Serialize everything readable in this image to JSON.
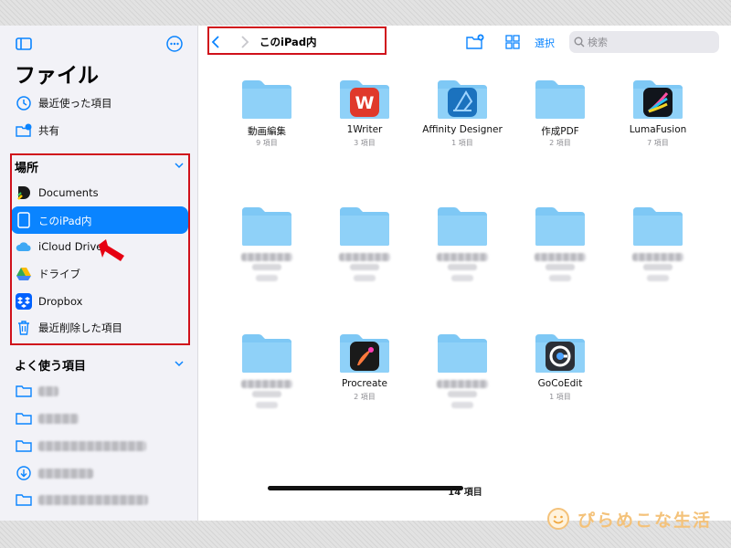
{
  "sidebar": {
    "title": "ファイル",
    "top_items": [
      {
        "label": "最近使った項目",
        "icon": "clock-icon"
      },
      {
        "label": "共有",
        "icon": "shared-folder-icon"
      }
    ],
    "locations_header": "場所",
    "locations": [
      {
        "label": "Documents",
        "icon": "documents-app-icon"
      },
      {
        "label": "このiPad内",
        "icon": "ipad-icon",
        "selected": true
      },
      {
        "label": "iCloud Drive",
        "icon": "icloud-icon"
      },
      {
        "label": "ドライブ",
        "icon": "google-drive-icon"
      },
      {
        "label": "Dropbox",
        "icon": "dropbox-icon"
      },
      {
        "label": "最近削除した項目",
        "icon": "trash-icon"
      }
    ],
    "favorites_header": "よく使う項目",
    "favorites": [
      {
        "label": "",
        "icon": "folder-icon"
      },
      {
        "label": "",
        "icon": "folder-icon"
      },
      {
        "label": "",
        "icon": "folder-icon"
      },
      {
        "label": "",
        "icon": "download-icon"
      },
      {
        "label": "",
        "icon": "folder-icon"
      }
    ]
  },
  "toolbar": {
    "title": "このiPad内",
    "select_label": "選択",
    "search_placeholder": "検索"
  },
  "grid": [
    {
      "name": "動画編集",
      "count": "9 項目",
      "app_icon": null
    },
    {
      "name": "1Writer",
      "count": "3 項目",
      "app_icon": "1writer-icon"
    },
    {
      "name": "Affinity Designer",
      "count": "1 項目",
      "app_icon": "affinity-designer-icon"
    },
    {
      "name": "作成PDF",
      "count": "2 項目",
      "app_icon": null
    },
    {
      "name": "LumaFusion",
      "count": "7 項目",
      "app_icon": "lumafusion-icon"
    },
    {
      "name": "",
      "count": "",
      "app_icon": null
    },
    {
      "name": "",
      "count": "",
      "app_icon": null
    },
    {
      "name": "",
      "count": "",
      "app_icon": null
    },
    {
      "name": "",
      "count": "",
      "app_icon": null
    },
    {
      "name": "",
      "count": "",
      "app_icon": null
    },
    {
      "name": "",
      "count": "",
      "app_icon": null
    },
    {
      "name": "Procreate",
      "count": "2 項目",
      "app_icon": "procreate-icon"
    },
    {
      "name": "",
      "count": "",
      "app_icon": null
    },
    {
      "name": "GoCoEdit",
      "count": "1 項目",
      "app_icon": "gocoedit-icon"
    }
  ],
  "item_count": "14 項目",
  "watermark": "ぴらめこな生活",
  "colors": {
    "accent": "#0a84ff",
    "folder": "#7ec8f5",
    "highlight_box": "#d0111b"
  }
}
